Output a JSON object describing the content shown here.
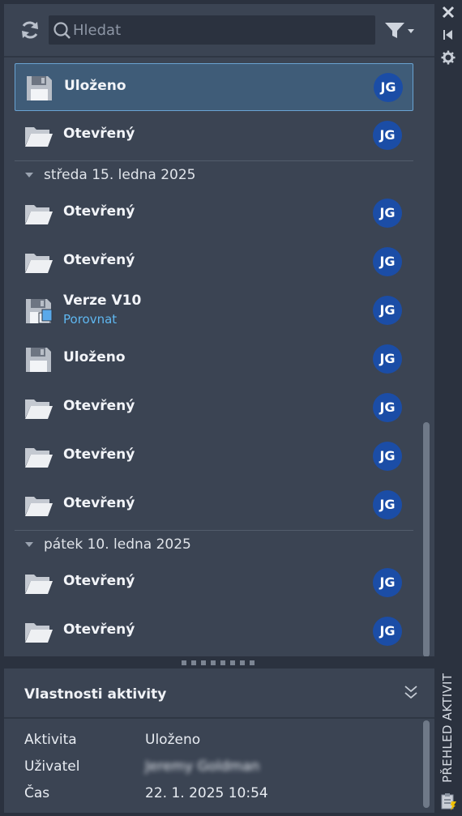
{
  "search": {
    "placeholder": "Hledat",
    "value": ""
  },
  "activities": [
    {
      "type": "saved",
      "title": "Uloženo",
      "user": "JG",
      "selected": true
    },
    {
      "type": "opened",
      "title": "Otevřený",
      "user": "JG"
    }
  ],
  "groups": [
    {
      "label": "středa 15. ledna 2025",
      "items": [
        {
          "type": "opened",
          "title": "Otevřený",
          "user": "JG"
        },
        {
          "type": "opened",
          "title": "Otevřený",
          "user": "JG"
        },
        {
          "type": "version",
          "title": "Verze V10",
          "link": "Porovnat",
          "user": "JG"
        },
        {
          "type": "saved",
          "title": "Uloženo",
          "user": "JG"
        },
        {
          "type": "opened",
          "title": "Otevřený",
          "user": "JG"
        },
        {
          "type": "opened",
          "title": "Otevřený",
          "user": "JG"
        },
        {
          "type": "opened",
          "title": "Otevřený",
          "user": "JG"
        }
      ]
    },
    {
      "label": "pátek 10. ledna 2025",
      "items": [
        {
          "type": "opened",
          "title": "Otevřený",
          "user": "JG"
        },
        {
          "type": "opened",
          "title": "Otevřený",
          "user": "JG"
        }
      ]
    }
  ],
  "properties": {
    "title": "Vlastnosti aktivity",
    "rows": [
      {
        "key": "Aktivita",
        "value": "Uloženo"
      },
      {
        "key": "Uživatel",
        "value": "Jeremy Goldman"
      },
      {
        "key": "Čas",
        "value": "22. 1. 2025 10:54"
      }
    ]
  },
  "rail": {
    "title": "PŘEHLED AKTIVIT"
  },
  "colors": {
    "accent": "#5fb7f0",
    "avatar": "#1b4da6",
    "selected": "#3f5c78",
    "panel": "#3b4453"
  }
}
